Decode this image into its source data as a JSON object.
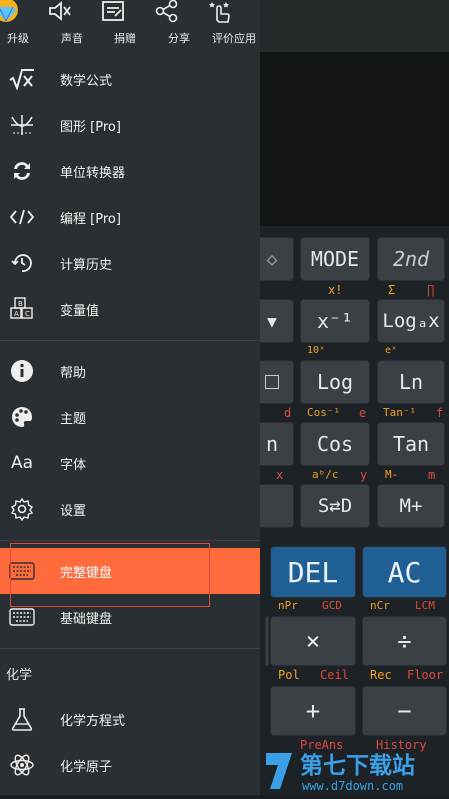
{
  "top_actions": [
    {
      "label": "升级",
      "icon": "gem-icon"
    },
    {
      "label": "声音",
      "icon": "speaker-mute-icon"
    },
    {
      "label": "捐赠",
      "icon": "donate-icon"
    },
    {
      "label": "分享",
      "icon": "share-icon"
    },
    {
      "label": "评价应用",
      "icon": "rate-app-icon"
    }
  ],
  "menu": {
    "group1": [
      {
        "label": "数学公式",
        "icon": "sqrt-icon"
      },
      {
        "label": "图形 [Pro]",
        "icon": "graph-icon"
      },
      {
        "label": "单位转换器",
        "icon": "convert-icon"
      },
      {
        "label": "编程 [Pro]",
        "icon": "code-icon"
      },
      {
        "label": "计算历史",
        "icon": "history-icon"
      },
      {
        "label": "变量值",
        "icon": "variable-blocks-icon"
      }
    ],
    "group2": [
      {
        "label": "帮助",
        "icon": "info-icon"
      },
      {
        "label": "主题",
        "icon": "palette-icon"
      },
      {
        "label": "字体",
        "icon": "font-icon"
      },
      {
        "label": "设置",
        "icon": "gear-icon"
      }
    ],
    "group3": [
      {
        "label": "完整键盘",
        "icon": "keyboard-icon",
        "active": true
      },
      {
        "label": "基础键盘",
        "icon": "keyboard-icon"
      }
    ],
    "chem_section": "化学",
    "group4": [
      {
        "label": "化学方程式",
        "icon": "flask-icon"
      },
      {
        "label": "化学原子",
        "icon": "atom-icon"
      }
    ]
  },
  "calc": {
    "keys": {
      "mode": "MODE",
      "second": "2nd",
      "inv": "x⁻¹",
      "loga": "Logₐx",
      "log": "Log",
      "ln": "Ln",
      "n": "n",
      "cos": "Cos",
      "tan": "Tan",
      "sd": "S⇄D",
      "mplus": "M+",
      "del": "DEL",
      "ac": "AC",
      "times": "×",
      "div": "÷",
      "plus": "+",
      "minus": "−"
    },
    "labels": {
      "x_fact": "x!",
      "sigma": "Σ",
      "pi_prod": "∏",
      "ten_x": "10ˣ",
      "e_x": "eˣ",
      "d": "d",
      "cos_inv": "Cos⁻¹",
      "e": "e",
      "tan_inv": "Tan⁻¹",
      "x": "x",
      "abc": "aᵇ/c",
      "y": "y",
      "m_minus": "M-",
      "m": "m",
      "npr": "nPr",
      "gcd": "GCD",
      "ncr": "nCr",
      "lcm": "LCM",
      "pol": "Pol",
      "ceil": "Ceil",
      "rec": "Rec",
      "floor": "Floor",
      "preans": "PreAns",
      "history": "History"
    }
  },
  "watermark": {
    "brand": "第七下载站",
    "url": "www.d7down.com"
  },
  "colors": {
    "accent": "#ff6b3d",
    "drawer": "#292f33",
    "key": "#3a4044",
    "key_blue": "#1f5f93",
    "orange": "#f0a020",
    "red": "#e0483a"
  }
}
